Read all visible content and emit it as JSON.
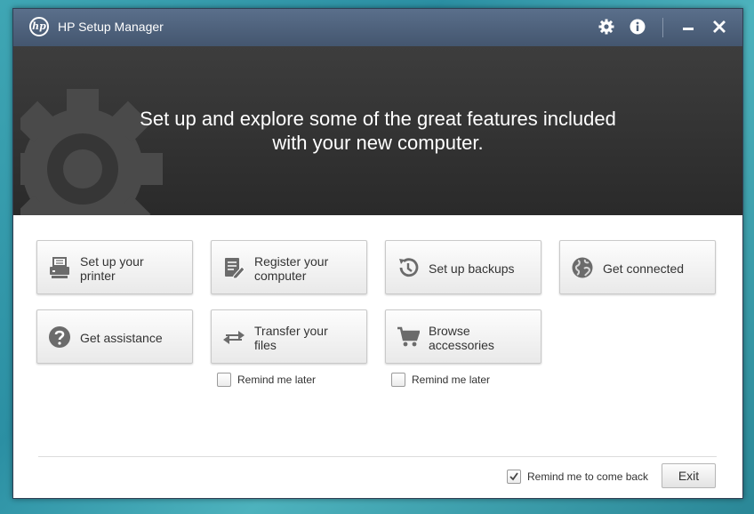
{
  "window": {
    "title": "HP Setup Manager",
    "logo_text": "hp"
  },
  "titlebar": {
    "icons": [
      "settings-gear-icon",
      "info-icon",
      "minimize-icon",
      "close-icon"
    ]
  },
  "banner": {
    "line1": "Set up and explore some of the great features included",
    "line2": "with your new computer."
  },
  "tiles": [
    {
      "icon": "printer-icon",
      "line1": "Set up your",
      "line2": "printer"
    },
    {
      "icon": "register-document-icon",
      "line1": "Register your",
      "line2": "computer"
    },
    {
      "icon": "backup-history-icon",
      "line1": "Set up backups",
      "line2": ""
    },
    {
      "icon": "globe-icon",
      "line1": "Get connected",
      "line2": ""
    },
    {
      "icon": "help-question-icon",
      "line1": "Get assistance",
      "line2": ""
    },
    {
      "icon": "transfer-arrows-icon",
      "line1": "Transfer your",
      "line2": "files"
    },
    {
      "icon": "shopping-cart-icon",
      "line1": "Browse",
      "line2": "accessories"
    }
  ],
  "reminders": {
    "transfer_label": "Remind me later",
    "transfer_checked": false,
    "accessories_label": "Remind me later",
    "accessories_checked": false
  },
  "footer": {
    "remind_label": "Remind me to come back",
    "remind_checked": true,
    "exit_label": "Exit"
  },
  "colors": {
    "titlebar": "#4f627c",
    "banner": "#333333",
    "icon_gray": "#6b6b6b",
    "desktop": "#3fa6b4"
  }
}
